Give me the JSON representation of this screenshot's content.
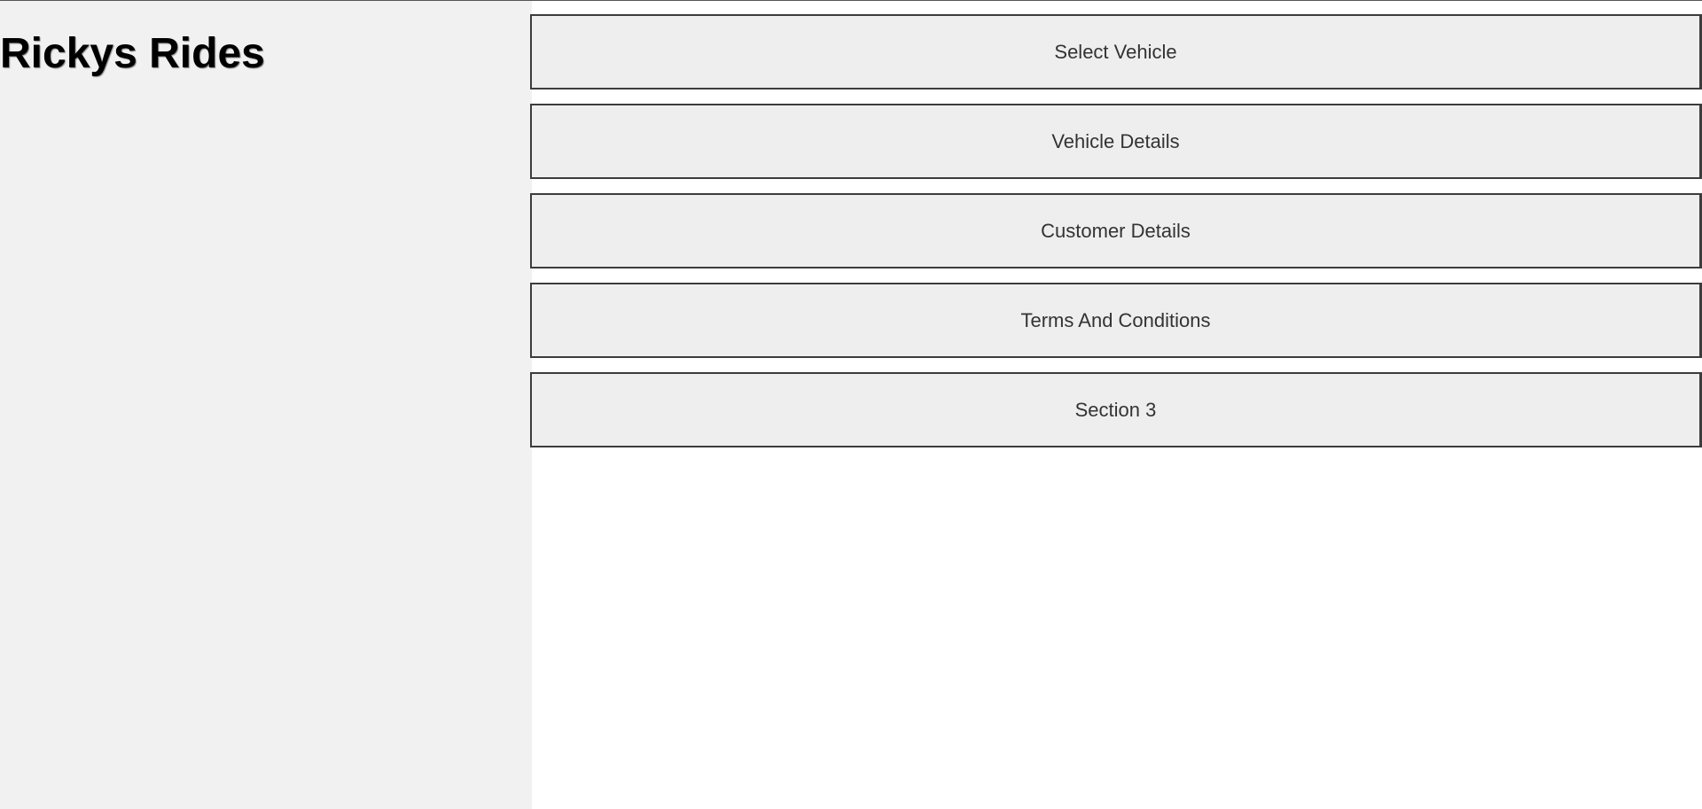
{
  "app": {
    "title": "Rickys Rides"
  },
  "sections": [
    {
      "label": "Select Vehicle"
    },
    {
      "label": "Vehicle Details"
    },
    {
      "label": "Customer Details"
    },
    {
      "label": "Terms And Conditions"
    },
    {
      "label": "Section 3"
    }
  ],
  "colors": {
    "sidebar_background": "#f1f1f1",
    "button_background": "#eeeeee",
    "button_border": "#3c3c3c",
    "page_background": "#ffffff"
  }
}
